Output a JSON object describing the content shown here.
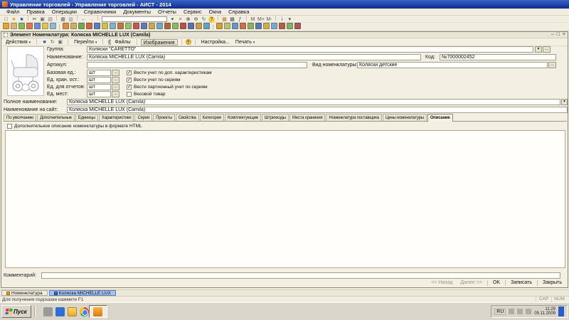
{
  "ui": {
    "caret": "▾",
    "dots": "...",
    "min": "–",
    "max": "□",
    "close": "×"
  },
  "app": {
    "title": "Управление торговлей - Управление торговлей - АИСТ - 2014",
    "menu": [
      {
        "name": "menu-item-file",
        "label": "Файл"
      },
      {
        "name": "menu-item-edit",
        "label": "Правка"
      },
      {
        "name": "menu-item-operations",
        "label": "Операции"
      },
      {
        "name": "menu-item-directories",
        "label": "Справочники"
      },
      {
        "name": "menu-item-documents",
        "label": "Документы"
      },
      {
        "name": "menu-item-reports",
        "label": "Отчеты"
      },
      {
        "name": "menu-item-service",
        "label": "Сервис"
      },
      {
        "name": "menu-item-windows",
        "label": "Окна"
      },
      {
        "name": "menu-item-help",
        "label": "Справка"
      }
    ],
    "search_value": "",
    "tb1a": [
      {
        "name": "new-document-icon",
        "g": "□",
        "c": "#55504a"
      },
      {
        "name": "open-folder-icon",
        "g": "■",
        "c": "#dcb23c"
      },
      {
        "name": "save-icon",
        "g": "■",
        "c": "#3d5fc4"
      },
      {
        "sep": true
      },
      {
        "name": "cut-icon",
        "g": "✂",
        "c": "#333"
      },
      {
        "name": "copy-icon",
        "g": "▣",
        "c": "#667"
      },
      {
        "name": "paste-icon",
        "g": "▤",
        "c": "#778"
      },
      {
        "sep": true
      },
      {
        "name": "print-icon",
        "g": "▦",
        "c": "#666"
      },
      {
        "name": "preview-icon",
        "g": "▥",
        "c": "#889"
      },
      {
        "sep": true
      },
      {
        "name": "undo-icon",
        "g": "←",
        "c": "#3a56b0"
      },
      {
        "name": "redo-icon",
        "g": "→",
        "c": "#9a968a"
      },
      {
        "sep": true
      }
    ],
    "tb1b": [
      {
        "name": "find-dropdown-icon",
        "g": "▾",
        "c": "#444"
      },
      {
        "name": "find-clear-icon",
        "g": "×",
        "c": "#a33"
      },
      {
        "name": "zoom-in-icon",
        "g": "⊕",
        "c": "#333"
      },
      {
        "name": "zoom-out-icon",
        "g": "⊖",
        "c": "#333"
      },
      {
        "name": "refresh-icon",
        "g": "↻",
        "c": "#2a7a3c"
      },
      {
        "name": "help-icon",
        "g": "?",
        "c": "#5a3c00",
        "bg": "#f2c84b",
        "round": true
      },
      {
        "sep": true
      },
      {
        "name": "calendar-icon",
        "g": "▦",
        "c": "#b07c3a"
      },
      {
        "name": "calculator-icon",
        "g": "▩",
        "c": "#556"
      },
      {
        "name": "formula-icon",
        "g": "ƒ",
        "c": "#346"
      },
      {
        "sep": true
      },
      {
        "name": "memory-button",
        "label": "M",
        "c": "#555"
      },
      {
        "name": "memory-plus-button",
        "label": "M+",
        "c": "#555"
      },
      {
        "name": "memory-minus-button",
        "label": "M-",
        "c": "#555"
      },
      {
        "sep": true
      },
      {
        "name": "info-icon",
        "g": "i",
        "c": "#2255cc"
      },
      {
        "name": "info-dropdown-icon",
        "g": "▾",
        "c": "#444"
      }
    ],
    "tb2_g1": [
      {
        "name": "toolbar-icon",
        "bg": "#e8a23c"
      },
      {
        "name": "toolbar-icon",
        "bg": "#d0b878"
      },
      {
        "name": "toolbar-icon",
        "bg": "#88b860"
      },
      {
        "name": "toolbar-icon",
        "bg": "#d87858"
      },
      {
        "name": "toolbar-icon",
        "bg": "#6890cc"
      },
      {
        "name": "toolbar-icon",
        "bg": "#d8c858"
      },
      {
        "name": "toolbar-icon",
        "bg": "#90b8d8"
      }
    ],
    "tb2_g2": [
      {
        "name": "toolbar-icon",
        "bg": "#d89040"
      },
      {
        "name": "toolbar-icon",
        "bg": "#c8b068"
      },
      {
        "name": "toolbar-icon",
        "bg": "#70a858"
      },
      {
        "name": "toolbar-icon",
        "bg": "#cc6848"
      },
      {
        "name": "toolbar-icon",
        "bg": "#5880c0"
      },
      {
        "name": "toolbar-icon",
        "bg": "#d0c050"
      },
      {
        "name": "toolbar-icon",
        "bg": "#80b0d0"
      },
      {
        "name": "toolbar-icon",
        "bg": "#b87848"
      },
      {
        "name": "toolbar-icon",
        "bg": "#98c070"
      },
      {
        "name": "toolbar-icon",
        "bg": "#c05858"
      },
      {
        "name": "toolbar-icon",
        "bg": "#6078b8"
      },
      {
        "name": "toolbar-icon",
        "bg": "#c8a850"
      },
      {
        "name": "toolbar-icon",
        "bg": "#70a8c8"
      },
      {
        "name": "toolbar-icon",
        "bg": "#a86840"
      },
      {
        "name": "toolbar-icon",
        "bg": "#88b868"
      },
      {
        "name": "toolbar-icon",
        "bg": "#b85050"
      },
      {
        "name": "toolbar-icon",
        "bg": "#5870b0"
      },
      {
        "name": "toolbar-icon",
        "bg": "#c0a048"
      },
      {
        "name": "toolbar-icon",
        "bg": "#68a0c0"
      }
    ],
    "tb2_g3": [
      {
        "name": "toolbar-icon",
        "bg": "#d0a040"
      },
      {
        "name": "toolbar-icon",
        "bg": "#b8c080"
      },
      {
        "name": "toolbar-icon",
        "bg": "#6898c8"
      },
      {
        "name": "toolbar-icon",
        "bg": "#c87050"
      },
      {
        "name": "toolbar-icon",
        "bg": "#90b060"
      },
      {
        "name": "toolbar-icon",
        "bg": "#5878b8"
      },
      {
        "name": "toolbar-icon",
        "bg": "#c8b058"
      },
      {
        "name": "toolbar-icon",
        "bg": "#78a8d0"
      },
      {
        "name": "toolbar-icon",
        "bg": "#b06048"
      },
      {
        "name": "toolbar-icon",
        "bg": "#80b070"
      },
      {
        "name": "toolbar-icon",
        "bg": "#a85858"
      }
    ]
  },
  "win": {
    "title": "Элемент Номенклатура: Коляска MICHELLE LUX (Camila)",
    "toolbar": {
      "actions": "Действия",
      "go": "Перейти",
      "files": "Файлы",
      "images": "Изображения",
      "help": "?",
      "settings": "Настройка...",
      "print": "Печать"
    },
    "toolbar_icons": [
      {
        "name": "save-icon",
        "g": "■",
        "c": "#3d5fc4"
      },
      {
        "name": "reread-icon",
        "g": "↻",
        "c": "#2a7a3c"
      },
      {
        "name": "copy-icon",
        "g": "▣",
        "c": "#667"
      }
    ],
    "fields": {
      "group_label": "Группа:",
      "group_value": "Коляски \"CARETTO\"",
      "name_label": "Наименование:",
      "name_value": "Коляска MICHELLE LUX (Camila)",
      "code_label": "Код:",
      "code_value": "№7000002452",
      "article_label": "Артикул:",
      "article_value": "",
      "kind_label": "Вид номенклатуры:",
      "kind_value": "Коляски детские",
      "fullname_label": "Полное наименование:",
      "fullname_value": "Коляска MICHELLE LUX (Camila)",
      "sitename_label": "Наименование на сайт:",
      "sitename_value": "Коляска MICHELLE LUX (Camila)",
      "comment_label": "Комментарий:",
      "comment_value": ""
    },
    "units": [
      {
        "label": "Базовая ед.:",
        "value": "шт",
        "check": "✓",
        "cblabel": "Вести учет по доп. характеристикам"
      },
      {
        "label": "Ед. хран. ост.:",
        "value": "шт",
        "check": "✓",
        "cblabel": "Вести учет по сериям"
      },
      {
        "label": "Ед. для отчетов:",
        "value": "шт",
        "check": "✓",
        "cblabel": "Вести партионный учет по сериям"
      },
      {
        "label": "Ед. мест:",
        "value": "шт",
        "check": "",
        "cblabel": "Весовой товар"
      }
    ],
    "tabs": [
      {
        "name": "tab-default",
        "label": "По умолчанию"
      },
      {
        "name": "tab-additional",
        "label": "Дополнительные"
      },
      {
        "name": "tab-units",
        "label": "Единицы"
      },
      {
        "name": "tab-characteristics",
        "label": "Характеристики"
      },
      {
        "name": "tab-series",
        "label": "Серии"
      },
      {
        "name": "tab-projects",
        "label": "Проекты"
      },
      {
        "name": "tab-properties",
        "label": "Свойства"
      },
      {
        "name": "tab-categories",
        "label": "Категории"
      },
      {
        "name": "tab-components",
        "label": "Комплектующие"
      },
      {
        "name": "tab-barcodes",
        "label": "Штрихкоды"
      },
      {
        "name": "tab-storage-locations",
        "label": "Места хранения"
      },
      {
        "name": "tab-supplier-nomenclature",
        "label": "Номенклатура поставщика"
      },
      {
        "name": "tab-nomenclature-prices",
        "label": "Цены номенклатуры"
      },
      {
        "name": "tab-description",
        "label": "Описание",
        "active": true
      }
    ],
    "desc_check": "",
    "desc_checkbox_label": "Дополнительное описание номенклатуры в формате HTML",
    "buttons": {
      "back": "<< Назад",
      "next": "Далее >>",
      "ok": "OK",
      "write": "Записать",
      "close": "Закрыть"
    }
  },
  "mdi": {
    "tabs": [
      {
        "label": "Номенклатура"
      },
      {
        "label": "Коляска MICHELLE LUX"
      }
    ]
  },
  "statusbar": {
    "hint": "Для получения подсказки нажмите F1",
    "cap": "CAP",
    "num": "NUM"
  },
  "taskbar": {
    "start_label": "Пуск",
    "lang": "RU",
    "time": "11:29",
    "date": "05.11.2009"
  }
}
